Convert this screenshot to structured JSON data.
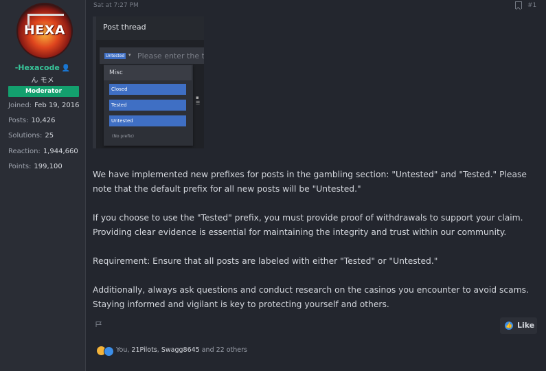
{
  "user": {
    "avatar_text": "HEXA",
    "username": "-Hexacode",
    "user_title": "ん モメ",
    "badge": "Moderator",
    "stats": [
      {
        "label": "Joined:",
        "value": "Feb 19, 2016"
      },
      {
        "label": "Posts:",
        "value": "10,426"
      },
      {
        "label": "Solutions:",
        "value": "25"
      },
      {
        "label": "Reaction:",
        "value": "1,944,660"
      },
      {
        "label": "Points:",
        "value": "199,100"
      }
    ]
  },
  "post": {
    "timestamp": "Sat at 7:27 PM",
    "post_number": "#1",
    "embedded_screenshot": {
      "title": "Post thread",
      "prefix_tag": "Untested",
      "placeholder": "Please enter the t",
      "menu_header": "Misc",
      "options": [
        "Closed",
        "Tested",
        "Untested"
      ],
      "no_prefix": "(No prefix)"
    },
    "paragraphs": [
      "We have implemented new prefixes for posts in the gambling section: \"Untested\" and \"Tested.\" Please note that the default prefix for all new posts will be \"Untested.\"",
      "If you choose to use the \"Tested\" prefix, you must provide proof of withdrawals to support your claim. Providing clear evidence is essential for maintaining the integrity and trust within our community.",
      "Requirement: Ensure that all posts are labeled with either \"Tested\" or \"Untested.\"",
      "Additionally, always ask questions and conduct research on the casinos you encounter to avoid scams. Staying informed and vigilant is key to protecting yourself and others."
    ],
    "like_label": "Like",
    "reactions": {
      "prefix": "You, ",
      "user1": "21Pilots",
      "sep": ", ",
      "user2": "Swagg8645",
      "suffix": " and 22 others"
    }
  }
}
